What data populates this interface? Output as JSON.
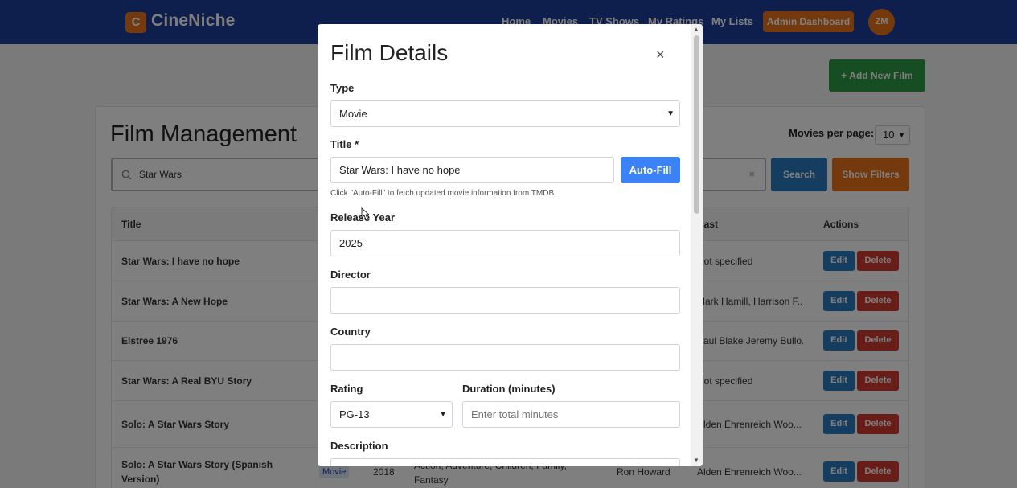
{
  "header": {
    "logo_letter": "C",
    "logo_text": "CineNiche",
    "nav": [
      "Home",
      "Movies",
      "TV Shows",
      "My Ratings",
      "My Lists"
    ],
    "admin_label": "Admin Dashboard",
    "avatar_initials": "ZM"
  },
  "page": {
    "add_button": "+ Add New Film",
    "title": "Film Management",
    "per_page_label": "Movies per page:",
    "per_page_value": "10",
    "search_value": "Star Wars",
    "search_clear": "×",
    "search_button": "Search",
    "filters_button": "Show Filters"
  },
  "table": {
    "headers": [
      "Title",
      "Cast",
      "Actions"
    ],
    "rows": [
      {
        "title": "Star Wars: I have no hope",
        "cast": "Not specified"
      },
      {
        "title": "Star Wars: A New Hope",
        "cast": "Mark Hamill, Harrison F..."
      },
      {
        "title": "Elstree 1976",
        "cast": "Paul Blake Jeremy Bullo..."
      },
      {
        "title": "Star Wars: A Real BYU Story",
        "cast": "Not specified"
      },
      {
        "title": "Solo: A Star Wars Story",
        "cast": "Alden Ehrenreich Woo..."
      },
      {
        "title": "Solo: A Star Wars Story (Spanish Version)",
        "type": "Movie",
        "year": "2018",
        "genres": "Action, Adventure, Children, Family, Fantasy",
        "director": "Ron Howard",
        "cast": "Alden Ehrenreich Woo..."
      }
    ],
    "edit_label": "Edit",
    "delete_label": "Delete"
  },
  "modal": {
    "title": "Film Details",
    "close": "×",
    "type_label": "Type",
    "type_value": "Movie",
    "title_label": "Title *",
    "title_value": "Star Wars: I have no hope",
    "autofill_label": "Auto-Fill",
    "help_text": "Click \"Auto-Fill\" to fetch updated movie information from TMDB.",
    "year_label": "Release Year",
    "year_value": "2025",
    "director_label": "Director",
    "director_value": "",
    "country_label": "Country",
    "country_value": "",
    "rating_label": "Rating",
    "rating_value": "PG-13",
    "duration_label": "Duration (minutes)",
    "duration_placeholder": "Enter total minutes",
    "description_label": "Description"
  }
}
